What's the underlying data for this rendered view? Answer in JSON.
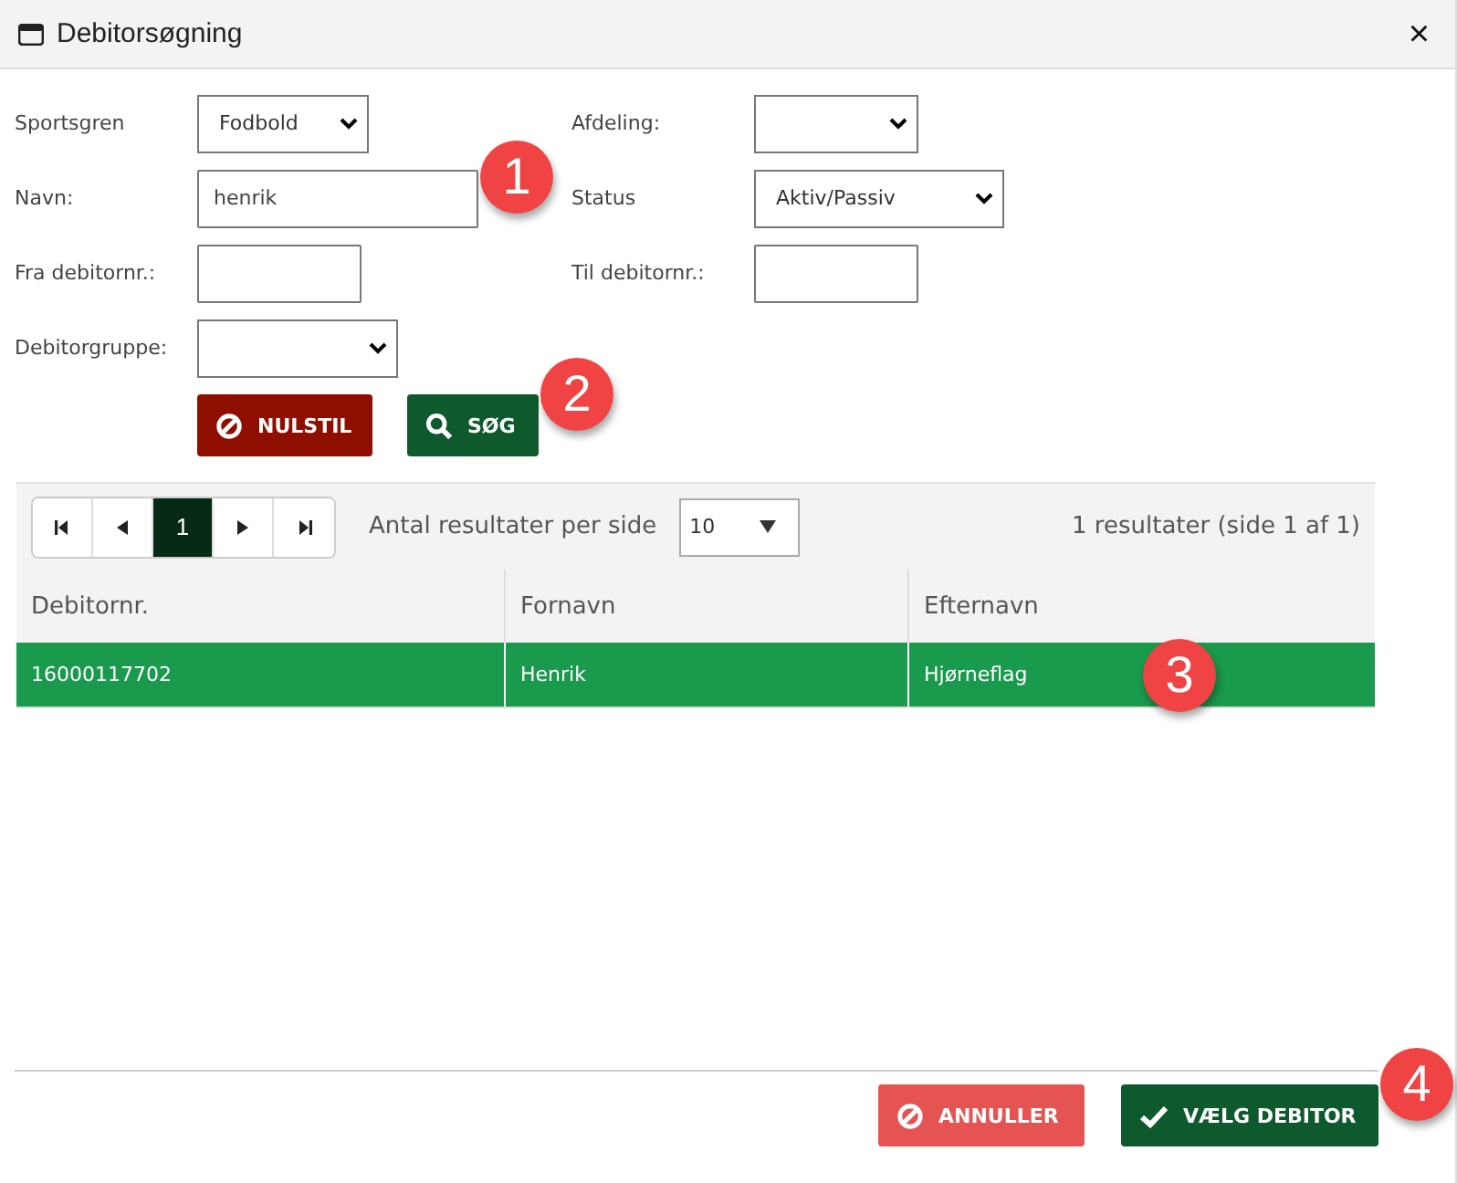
{
  "window": {
    "title": "Debitorsøgning",
    "close": "×"
  },
  "form": {
    "rows": [
      [
        {
          "label": "Sportsgren",
          "kind": "select",
          "value": "Fodbold"
        },
        {
          "label": "Afdeling:",
          "kind": "select"
        }
      ],
      [
        {
          "label": "Navn:",
          "kind": "input",
          "value": "henrik",
          "badge": "1"
        },
        {
          "label": "Status",
          "kind": "select",
          "value": "Aktiv/Passiv"
        }
      ],
      [
        {
          "label": "Fra debitornr.:",
          "kind": "input"
        },
        {
          "label": "Til debitornr.:",
          "kind": "input"
        }
      ],
      [
        {
          "label": "Debitorgruppe:",
          "kind": "select"
        }
      ]
    ]
  },
  "actions": [
    {
      "label": "NULSTIL",
      "kind": "reset"
    },
    {
      "label": "SØG",
      "kind": "search",
      "badge": "2"
    }
  ],
  "pager": {
    "buttons": [
      {
        "kind": "first",
        "selected": false
      },
      {
        "kind": "prev",
        "selected": false
      },
      {
        "kind": "page",
        "label": "1",
        "selected": true
      },
      {
        "kind": "next",
        "selected": false
      },
      {
        "kind": "last",
        "selected": false
      }
    ],
    "per_page_label": "Antal resultater per side",
    "per_page": "10",
    "summary": "1 resultater (side 1 af 1)"
  },
  "table": {
    "columns": [
      "Debitornr.",
      "Fornavn",
      "Efternavn"
    ],
    "rows": [
      {
        "cells": [
          "16000117702",
          "Henrik",
          "Hjørneflag"
        ],
        "selected": true,
        "badge": "3"
      }
    ]
  },
  "footer": {
    "buttons": [
      {
        "label": "ANNULLER",
        "kind": "cancel"
      },
      {
        "label": "VÆLG DEBITOR",
        "kind": "confirm",
        "badge": "4"
      }
    ]
  }
}
